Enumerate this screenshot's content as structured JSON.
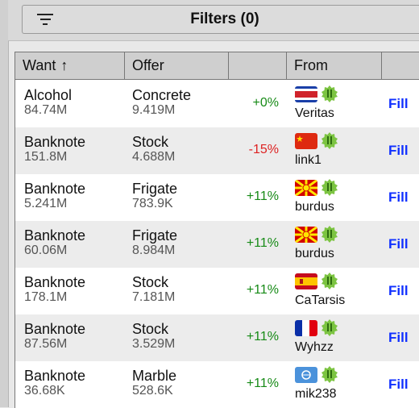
{
  "filters": {
    "label": "Filters (0)",
    "icon": "filter-icon"
  },
  "table": {
    "headers": {
      "want": "Want",
      "want_sort": "↑",
      "offer": "Offer",
      "pct": "",
      "from": "From",
      "fill": ""
    },
    "rows": [
      {
        "want": "Alcohol",
        "want_qty": "84.74M",
        "offer": "Concrete",
        "offer_qty": "9.419M",
        "pct": "+0%",
        "pct_sign": "pos",
        "flag": "costa-rica",
        "user": "Veritas",
        "action": "Fill"
      },
      {
        "want": "Banknote",
        "want_qty": "151.8M",
        "offer": "Stock",
        "offer_qty": "4.688M",
        "pct": "-15%",
        "pct_sign": "neg",
        "flag": "china",
        "user": "link1",
        "action": "Fill"
      },
      {
        "want": "Banknote",
        "want_qty": "5.241M",
        "offer": "Frigate",
        "offer_qty": "783.9K",
        "pct": "+11%",
        "pct_sign": "pos",
        "flag": "macedonia",
        "user": "burdus",
        "action": "Fill"
      },
      {
        "want": "Banknote",
        "want_qty": "60.06M",
        "offer": "Frigate",
        "offer_qty": "8.984M",
        "pct": "+11%",
        "pct_sign": "pos",
        "flag": "macedonia",
        "user": "burdus",
        "action": "Fill"
      },
      {
        "want": "Banknote",
        "want_qty": "178.1M",
        "offer": "Stock",
        "offer_qty": "7.181M",
        "pct": "+11%",
        "pct_sign": "pos",
        "flag": "spain",
        "user": "CaTarsis",
        "action": "Fill"
      },
      {
        "want": "Banknote",
        "want_qty": "87.56M",
        "offer": "Stock",
        "offer_qty": "3.529M",
        "pct": "+11%",
        "pct_sign": "pos",
        "flag": "france",
        "user": "Wyhzz",
        "action": "Fill"
      },
      {
        "want": "Banknote",
        "want_qty": "36.68K",
        "offer": "Marble",
        "offer_qty": "528.6K",
        "pct": "+11%",
        "pct_sign": "pos",
        "flag": "un",
        "user": "mik238",
        "action": "Fill"
      }
    ]
  }
}
